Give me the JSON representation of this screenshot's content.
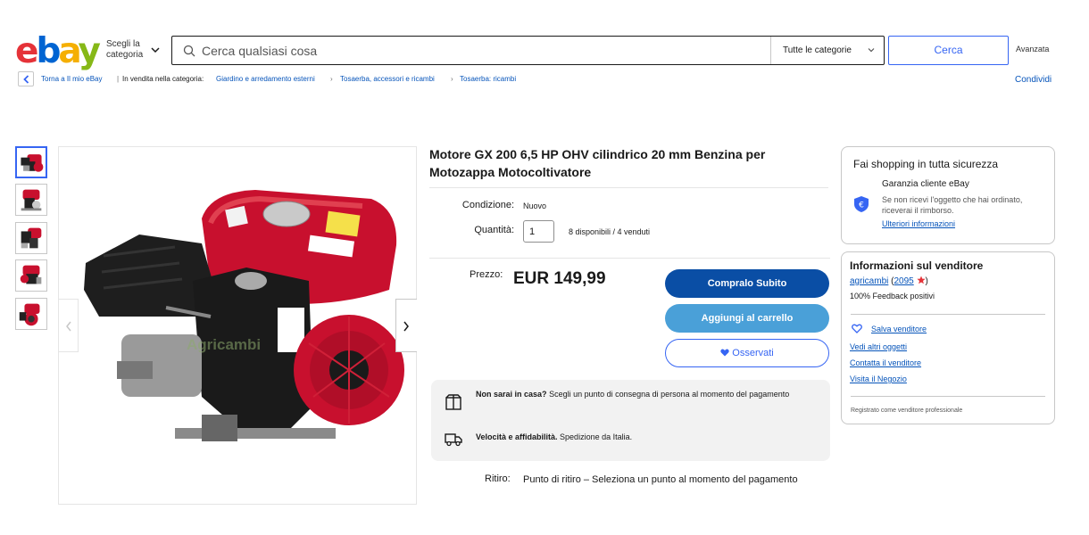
{
  "header": {
    "logo": "ebay",
    "shop_by": "Scegli la categoria",
    "search_placeholder": "Cerca qualsiasi cosa",
    "category_select": "Tutte le categorie",
    "search_button": "Cerca",
    "advanced": "Avanzata"
  },
  "breadcrumb": {
    "back": "Torna a Il mio eBay",
    "listed_in": "In vendita nella categoria:",
    "items": [
      "Giardino e arredamento esterni",
      "Tosaerba, accessori e ricambi",
      "Tosaerba: ricambi"
    ],
    "share": "Condividi"
  },
  "gallery": {
    "thumbnail_count": 5,
    "watermark": "Agricambi"
  },
  "product": {
    "title": "Motore GX 200 6,5 HP OHV cilindrico 20 mm Benzina per Motozappa Motocoltivatore",
    "condition_label": "Condizione:",
    "condition_value": "Nuovo",
    "quantity_label": "Quantità:",
    "quantity_value": "1",
    "availability": "8 disponibili / 4 venduti",
    "price_label": "Prezzo:",
    "price": "EUR 149,99",
    "buy_now": "Compralo Subito",
    "add_to_cart": "Aggiungi al carrello",
    "watch": "Osservati",
    "pickup_title": "Non sarai in casa?",
    "pickup_text": "Scegli un punto di consegna di persona al momento del pagamento",
    "shipping_title": "Velocità e affidabilità.",
    "shipping_text": "Spedizione da Italia.",
    "ritiro_label": "Ritiro:",
    "ritiro_value": "Punto di ritiro – Seleziona un punto al momento del pagamento"
  },
  "safe_panel": {
    "title": "Fai shopping in tutta sicurezza",
    "guarantee_title": "Garanzia cliente eBay",
    "guarantee_text": "Se non ricevi l'oggetto che hai ordinato, riceverai il rimborso.",
    "more_info": "Ulteriori informazioni"
  },
  "seller_panel": {
    "title": "Informazioni sul venditore",
    "name": "agricambi",
    "feedback_count": "2095",
    "feedback_positive": "100% Feedback positivi",
    "save_seller": "Salva venditore",
    "see_items": "Vedi altri oggetti",
    "contact": "Contatta il venditore",
    "visit_store": "Visita il Negozio",
    "registered": "Registrato come venditore professionale"
  },
  "colors": {
    "brand_blue": "#3665f3",
    "buy_button": "#0a4ea5",
    "cart_button": "#4aa0d8",
    "engine_red": "#c8102e"
  }
}
